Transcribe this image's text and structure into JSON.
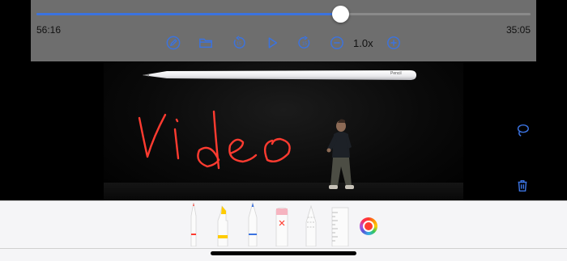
{
  "player": {
    "elapsed": "56:16",
    "remaining": "35:05",
    "speed": "1.0x",
    "progress": 0.614,
    "accent_color": "#3b73e0"
  },
  "controls": [
    {
      "name": "markup-icon"
    },
    {
      "name": "folder-icon"
    },
    {
      "name": "rewind-icon"
    },
    {
      "name": "play-icon"
    },
    {
      "name": "fast-forward-icon"
    },
    {
      "name": "speed-down-icon"
    },
    {
      "name": "speed-up-icon"
    }
  ],
  "video": {
    "product_label": "Pencil",
    "ink_color": "#ff3b30"
  },
  "side_tools": {
    "lasso_icon": "lasso-icon",
    "trash_icon": "trash-icon",
    "icon_color": "#3b73e0"
  },
  "palette": {
    "tools": [
      "pen",
      "marker",
      "pencil",
      "eraser",
      "lasso",
      "ruler"
    ],
    "selected_color": "#ff3b30"
  }
}
